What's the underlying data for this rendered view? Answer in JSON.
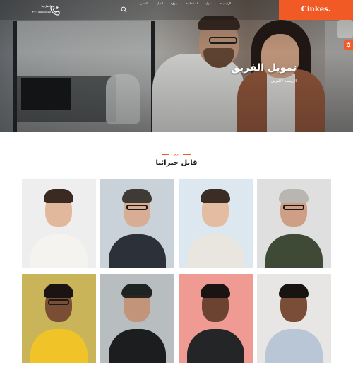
{
  "brand": {
    "name": "Cinkes."
  },
  "topbar": {
    "contact_label": "اتصل بنا",
    "contact_number": "+٩٦٦٥٥٥٥٥٥٥٥",
    "nav": [
      "الرئيسية",
      "حول",
      "الصفحات",
      "بلوق",
      "اتصل",
      "المتجر"
    ]
  },
  "hero": {
    "title": "تمويل الفريق",
    "subtitle": "الرئيسية / الفريق"
  },
  "team": {
    "kicker": "فريق",
    "title": "قابل خبرائنا"
  },
  "colors": {
    "accent": "#f15a24",
    "heading": "#1d1d1d",
    "background": "#ffffff"
  },
  "icons": [
    "phone-icon",
    "search-icon",
    "gear-icon"
  ],
  "members": [
    {
      "label": "woman-white-blazer",
      "bg": "#eeeeee",
      "skin": "#e2b89c",
      "hair": "#3a2a22",
      "clothes": "#f5f3f0",
      "glasses": false,
      "cap": false
    },
    {
      "label": "man-glasses-dark-blazer",
      "bg": "#c9d2d8",
      "skin": "#d7ad94",
      "hair": "#3f3a36",
      "clothes": "#2c3038",
      "glasses": true,
      "cap": false
    },
    {
      "label": "woman-beige-blazer",
      "bg": "#dce7f0",
      "skin": "#e3bca2",
      "hair": "#3b2d25",
      "clothes": "#e9e6e0",
      "glasses": false,
      "cap": false
    },
    {
      "label": "senior-man-green-shirt",
      "bg": "#dedfde",
      "skin": "#cf9f85",
      "hair": "#b9b5b1",
      "clothes": "#3e4a36",
      "glasses": true,
      "cap": false
    },
    {
      "label": "woman-yellow-top",
      "bg": "#c9b45a",
      "skin": "#7a4e34",
      "hair": "#1b1412",
      "clothes": "#f0c329",
      "glasses": true,
      "cap": false
    },
    {
      "label": "man-cap-black-tee",
      "bg": "#b8bdc0",
      "skin": "#c29479",
      "hair": "#2b2522",
      "clothes": "#1c1d1f",
      "glasses": false,
      "cap": true
    },
    {
      "label": "woman-pink-background",
      "bg": "#ef9a93",
      "skin": "#6b4330",
      "hair": "#1a1412",
      "clothes": "#242527",
      "glasses": false,
      "cap": false
    },
    {
      "label": "man-curly-hair-denim",
      "bg": "#e7e6e4",
      "skin": "#7a4e36",
      "hair": "#181412",
      "clothes": "#b9c6d6",
      "glasses": false,
      "cap": false
    }
  ]
}
